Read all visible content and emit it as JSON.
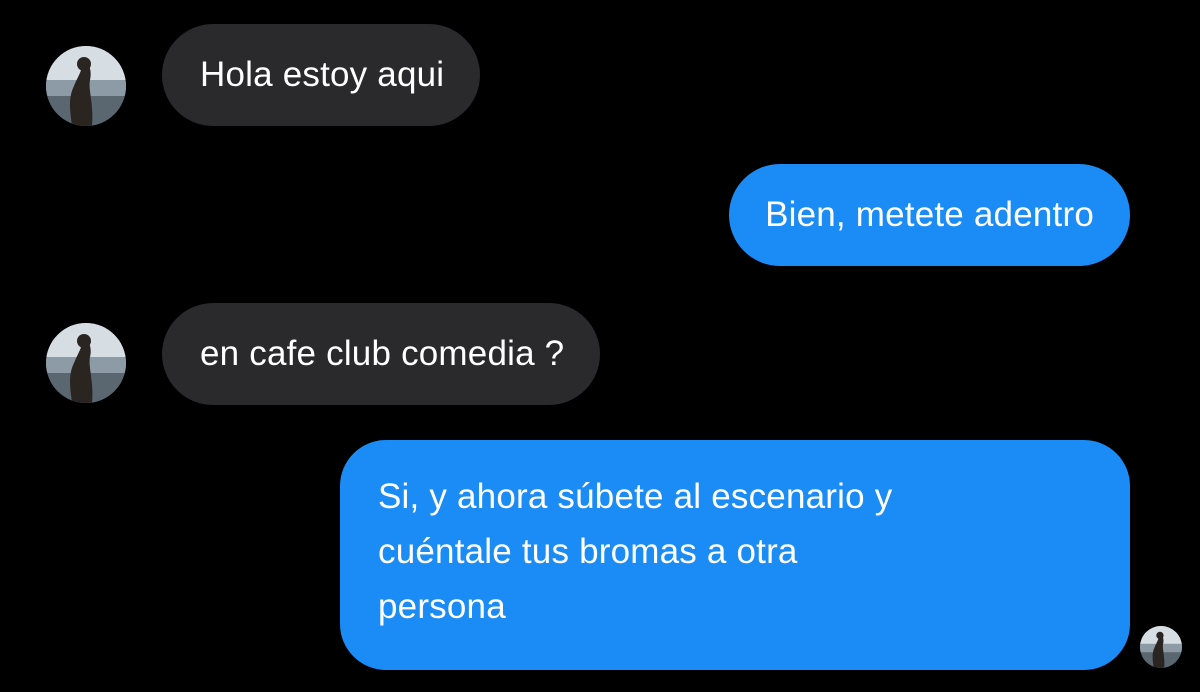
{
  "conversation": {
    "messages": [
      {
        "direction": "incoming",
        "text": "Hola estoy aqui",
        "avatar_icon": "profile-photo-icon"
      },
      {
        "direction": "outgoing",
        "text": "Bien, metete adentro"
      },
      {
        "direction": "incoming",
        "text": "en cafe club comedia ?",
        "avatar_icon": "profile-photo-icon"
      },
      {
        "direction": "outgoing",
        "text_lines": [
          "Si, y ahora súbete al escenario y",
          "cuéntale tus bromas a otra",
          "persona"
        ],
        "read_receipt_icon": "seen-avatar-icon"
      }
    ]
  },
  "colors": {
    "background": "#000000",
    "incoming_bubble": "#2a2a2c",
    "outgoing_bubble": "#1b8cf5",
    "text": "#ffffff"
  }
}
